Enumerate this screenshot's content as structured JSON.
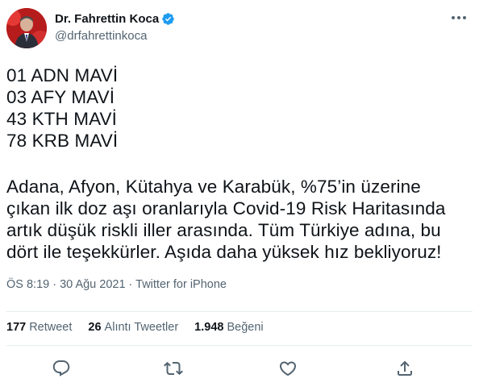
{
  "author": {
    "display_name": "Dr. Fahrettin Koca",
    "handle": "@drfahrettinkoca",
    "verified_color": "#1d9bf0"
  },
  "tweet": {
    "lines": [
      "01 ADN MAVİ",
      "03 AFY MAVİ",
      "43 KTH MAVİ",
      "78 KRB MAVİ"
    ],
    "paragraph": [
      "Adana, Afyon, Kütahya ve Karabük, %75’in üzerine",
      "çıkan ilk doz aşı oranlarıyla Covid-19 Risk Haritasında",
      "artık düşük riskli iller arasında. Tüm Türkiye adına, bu",
      "dört ile teşekkürler. Aşıda daha yüksek hız bekliyoruz!"
    ],
    "meta": "ÖS 8:19 · 30 Ağu 2021 · Twitter for iPhone"
  },
  "stats": {
    "retweets": {
      "count": "177",
      "label": "Retweet"
    },
    "quotes": {
      "count": "26",
      "label": "Alıntı Tweetler"
    },
    "likes": {
      "count": "1.948",
      "label": "Beğeni"
    }
  },
  "actions": {
    "reply_icon": "reply-icon",
    "retweet_icon": "retweet-icon",
    "like_icon": "like-icon",
    "share_icon": "share-icon"
  }
}
